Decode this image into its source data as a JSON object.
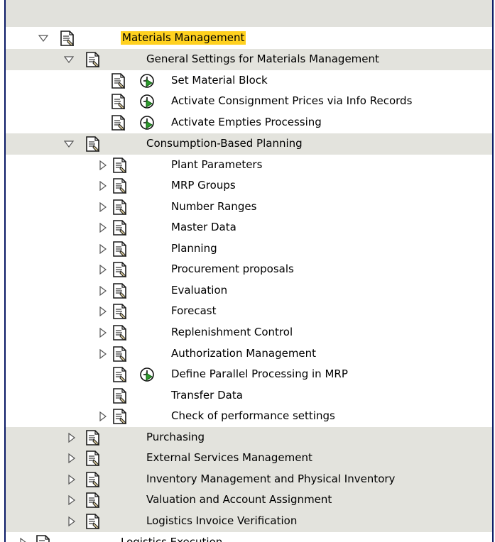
{
  "tree": {
    "root": {
      "label": "Materials Management",
      "expanded": true,
      "highlighted": true
    },
    "general_settings": {
      "label": "General Settings for Materials Management",
      "expanded": true,
      "children": [
        {
          "label": "Set Material Block",
          "icon": "clock-execute-icon"
        },
        {
          "label": "Activate Consignment Prices via Info Records",
          "icon": "clock-execute-icon"
        },
        {
          "label": "Activate Empties Processing",
          "icon": "clock-execute-icon"
        }
      ]
    },
    "consumption_planning": {
      "label": "Consumption-Based Planning",
      "expanded": true,
      "children": [
        {
          "label": "Plant Parameters"
        },
        {
          "label": "MRP Groups"
        },
        {
          "label": "Number Ranges"
        },
        {
          "label": "Master Data"
        },
        {
          "label": "Planning"
        },
        {
          "label": "Procurement proposals"
        },
        {
          "label": "Evaluation"
        },
        {
          "label": "Forecast"
        },
        {
          "label": "Replenishment Control"
        },
        {
          "label": "Authorization Management"
        },
        {
          "label": "Define Parallel Processing in MRP"
        },
        {
          "label": "Transfer Data"
        },
        {
          "label": "Check of performance settings"
        }
      ]
    },
    "siblings": [
      {
        "label": "Purchasing"
      },
      {
        "label": "External Services Management"
      },
      {
        "label": "Inventory Management and Physical Inventory"
      },
      {
        "label": "Valuation and Account Assignment"
      },
      {
        "label": "Logistics Invoice Verification"
      }
    ],
    "next_root": {
      "label": "Logistics Execution"
    }
  },
  "colors": {
    "highlight": "#ffd11f",
    "row_shade": "#e3e3dd",
    "frame": "#0a1a66",
    "clock_green": "#2c9a2c"
  }
}
